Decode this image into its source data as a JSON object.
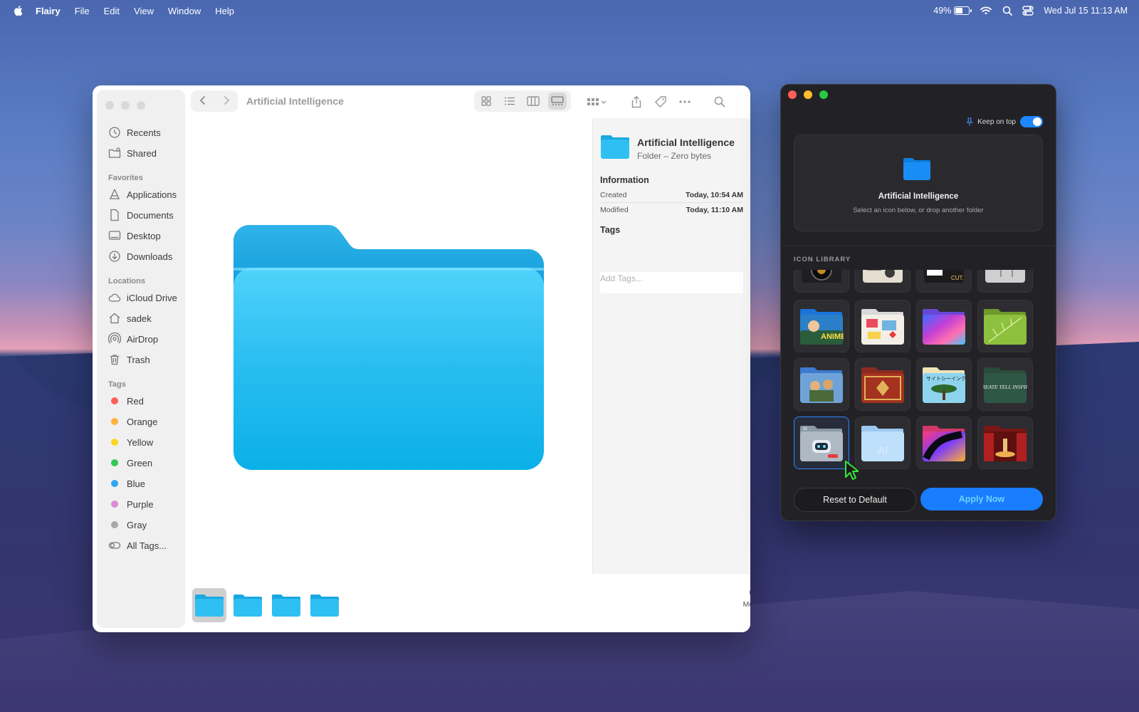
{
  "menubar": {
    "app_name": "Flairy",
    "items": [
      "File",
      "Edit",
      "View",
      "Window",
      "Help"
    ],
    "battery_percent": "49%",
    "battery_level": 0.49,
    "datetime": "Wed Jul 15  11:13 AM"
  },
  "finder": {
    "title": "Artificial Intelligence",
    "sidebar": {
      "top_items": [
        {
          "label": "Recents",
          "icon": "clock-icon"
        },
        {
          "label": "Shared",
          "icon": "shared-folder-icon"
        }
      ],
      "favorites_label": "Favorites",
      "favorites": [
        {
          "label": "Applications",
          "icon": "applications-icon"
        },
        {
          "label": "Documents",
          "icon": "document-icon"
        },
        {
          "label": "Desktop",
          "icon": "desktop-icon"
        },
        {
          "label": "Downloads",
          "icon": "download-icon"
        }
      ],
      "locations_label": "Locations",
      "locations": [
        {
          "label": "iCloud Drive",
          "icon": "cloud-icon"
        },
        {
          "label": "sadek",
          "icon": "home-icon"
        },
        {
          "label": "AirDrop",
          "icon": "airdrop-icon"
        },
        {
          "label": "Trash",
          "icon": "trash-icon"
        }
      ],
      "tags_label": "Tags",
      "tags": [
        {
          "label": "Red",
          "color": "#ff5f57"
        },
        {
          "label": "Orange",
          "color": "#ffb340"
        },
        {
          "label": "Yellow",
          "color": "#ffd426"
        },
        {
          "label": "Green",
          "color": "#34c759"
        },
        {
          "label": "Blue",
          "color": "#2fa7f2"
        },
        {
          "label": "Purple",
          "color": "#e08ad0"
        },
        {
          "label": "Gray",
          "color": "#a8a8a8"
        }
      ],
      "all_tags": "All Tags..."
    },
    "inspector": {
      "name": "Artificial Intelligence",
      "subtitle": "Folder – Zero bytes",
      "information_label": "Information",
      "created_label": "Created",
      "created_value": "Today, 10:54 AM",
      "modified_label": "Modified",
      "modified_value": "Today, 11:10 AM",
      "tags_label": "Tags",
      "tags_placeholder": "Add Tags..."
    },
    "more_label": "More...",
    "folder_color": "#1cb8f0"
  },
  "flairy": {
    "keep_on_top_label": "Keep on top",
    "keep_on_top": true,
    "preview_title": "Artificial Intelligence",
    "preview_subtitle": "Select an icon below, or drop another folder",
    "library_label": "ICON LIBRARY",
    "icons": [
      "camera-lens-folder-icon",
      "vintage-radio-folder-icon",
      "film-clapper-folder-icon",
      "sketch-chair-folder-icon",
      "anime-folder-icon",
      "scrapbook-folder-icon",
      "holographic-folder-icon",
      "leaf-folder-icon",
      "painting-folder-icon",
      "persian-rug-folder-icon",
      "bonsai-sightseeing-folder-icon",
      "chalkboard-folder-icon",
      "ai-robot-folder-icon",
      "ai-glass-folder-icon",
      "neon-abstract-folder-icon",
      "theater-stage-folder-icon"
    ],
    "selected_icon": "ai-robot-folder-icon",
    "anime_text": "ANIME",
    "chalk_text": "CREATE TELL INSPIRE",
    "japanese_text": "サイトシーイング",
    "clapper_text": "CUT.",
    "ai_badge": "AI",
    "reset_label": "Reset to Default",
    "apply_label": "Apply Now",
    "accent": "#1a7cff"
  }
}
